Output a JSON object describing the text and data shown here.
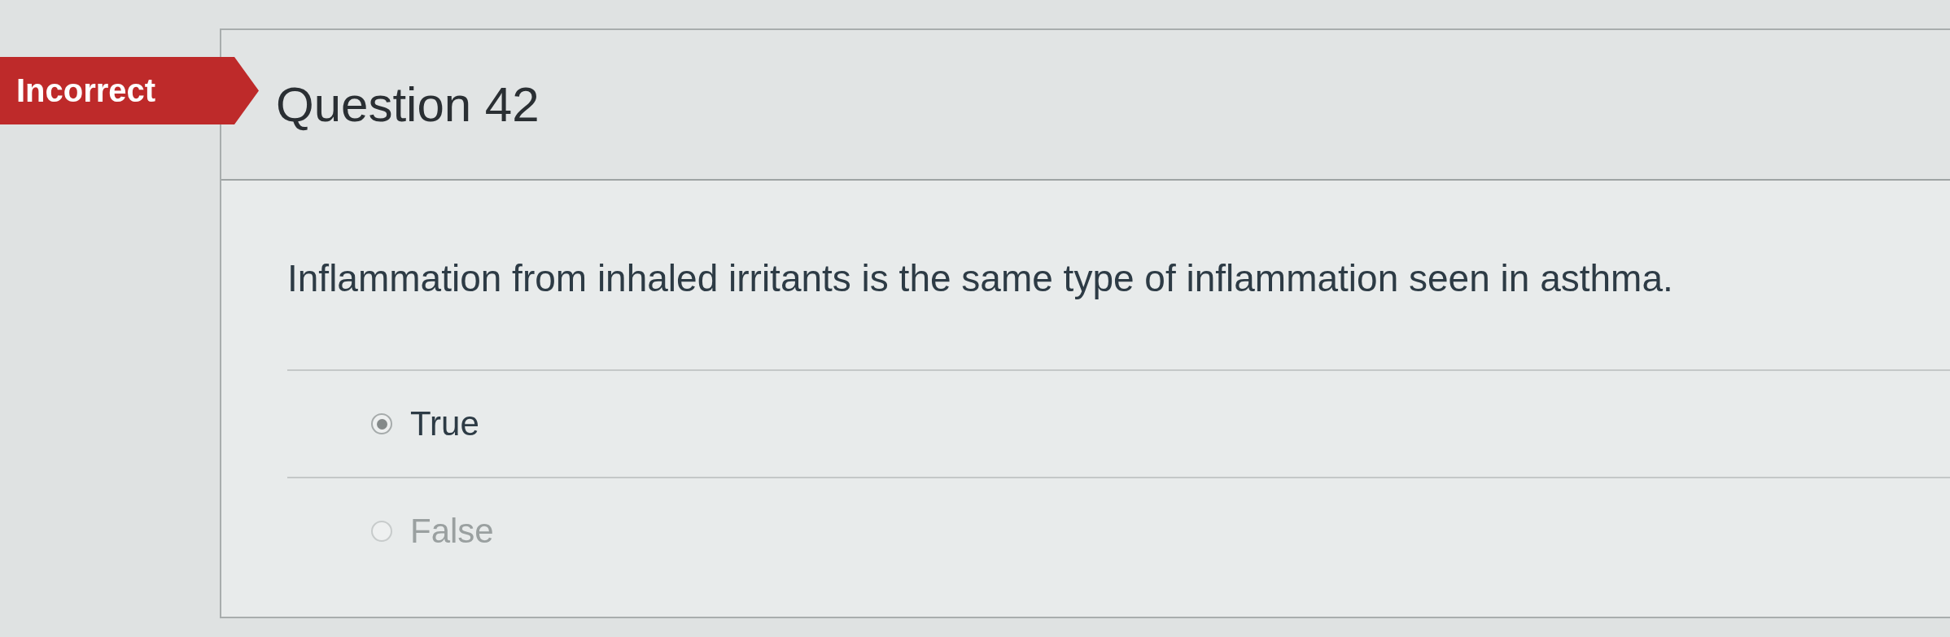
{
  "question": {
    "result_flag": "Incorrect",
    "title": "Question 42",
    "text": "Inflammation from inhaled irritants is the same type of inflammation seen in asthma.",
    "answers": [
      {
        "label": "True",
        "selected": true
      },
      {
        "label": "False",
        "selected": false
      }
    ]
  }
}
